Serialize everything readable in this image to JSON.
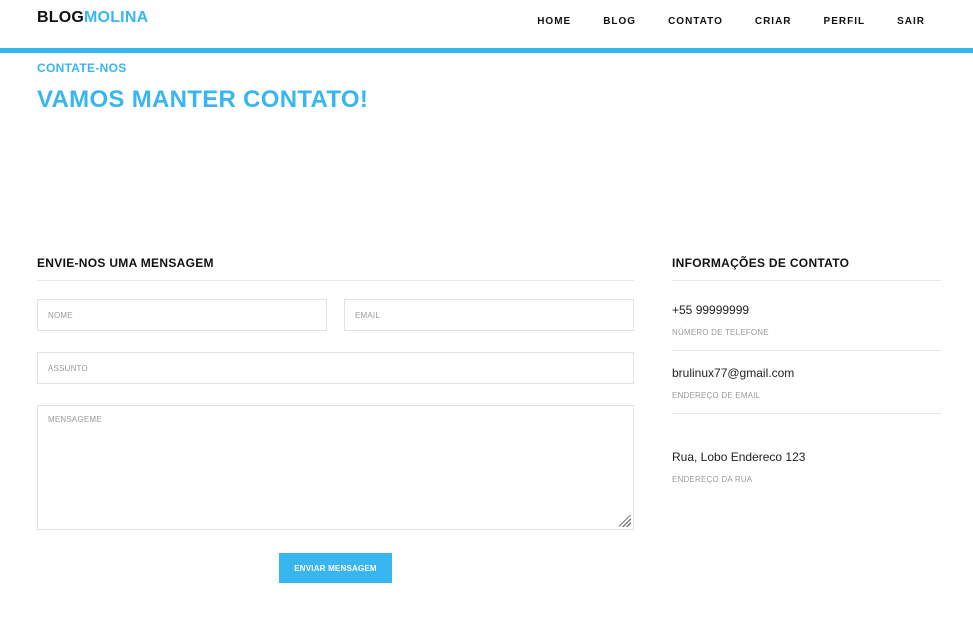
{
  "brand": {
    "part1": "BLOG",
    "part2": "MOLINA",
    "accent_color": "#38b6f0"
  },
  "nav": {
    "items": [
      {
        "label": "HOME"
      },
      {
        "label": "BLOG"
      },
      {
        "label": "CONTATO"
      },
      {
        "label": "CRIAR"
      },
      {
        "label": "PERFIL"
      },
      {
        "label": "SAIR"
      }
    ]
  },
  "hero": {
    "eyebrow": "CONTATE-NOS",
    "title": "VAMOS MANTER CONTATO!"
  },
  "form": {
    "heading": "ENVIE-NOS UMA MENSAGEM",
    "name_placeholder": "NOME",
    "email_placeholder": "EMAIL",
    "subject_placeholder": "ASSUNTO",
    "message_placeholder": "MENSAGEME",
    "name_value": "",
    "email_value": "",
    "subject_value": "",
    "message_value": "",
    "submit_label": "ENVIAR MENSAGEM"
  },
  "contact_info": {
    "heading": "INFORMAÇÕES DE CONTATO",
    "phone": {
      "value": "+55 99999999",
      "label": "NÚMERO DE TELEFONE"
    },
    "email": {
      "value": "brulinux77@gmail.com",
      "label": "ENDEREÇO DE EMAIL"
    },
    "address": {
      "value": "Rua, Lobo Endereco 123",
      "label": "ENDEREÇO DA RUA"
    }
  }
}
